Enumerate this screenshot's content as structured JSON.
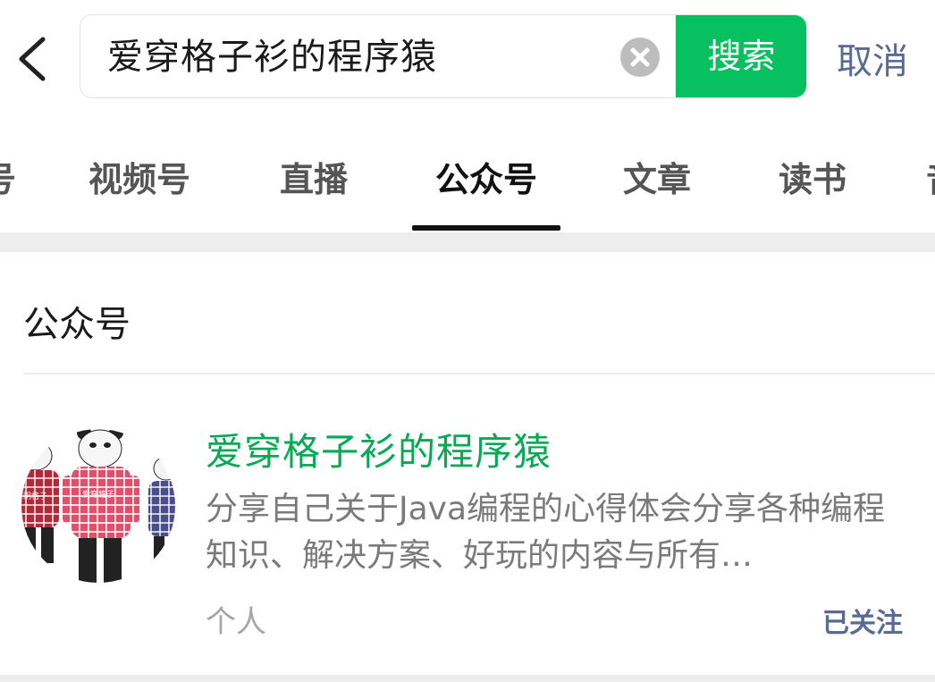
{
  "search": {
    "query": "爱穿格子衫的程序猿",
    "button_label": "搜索",
    "cancel_label": "取消"
  },
  "tabs": [
    {
      "label": "号"
    },
    {
      "label": "视频号"
    },
    {
      "label": "直播"
    },
    {
      "label": "公众号",
      "active": true
    },
    {
      "label": "文章"
    },
    {
      "label": "读书"
    },
    {
      "label": "音"
    }
  ],
  "section": {
    "title": "公众号"
  },
  "result": {
    "name": "爱穿格子衫的程序猿",
    "description": "分享自己关于Java编程的心得体会分享各种编程知识、解决方案、好玩的内容与所有…",
    "type": "个人",
    "follow_status": "已关注",
    "avatar_labels": [
      "阴格子",
      "爱穿格子"
    ]
  },
  "colors": {
    "accent_green": "#07c160",
    "link_blue": "#576b95"
  }
}
